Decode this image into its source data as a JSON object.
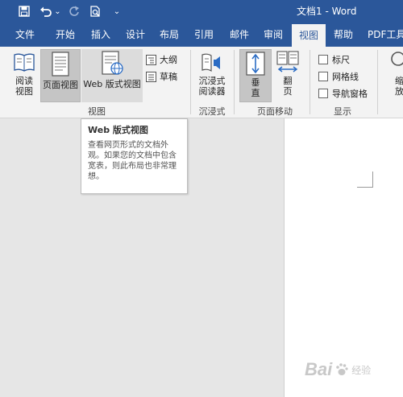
{
  "window": {
    "title": "文档1 - Word"
  },
  "quick_access": {
    "undo_menu": "⌄",
    "customize": "⌄"
  },
  "tabs": [
    {
      "label": "文件"
    },
    {
      "label": "开始"
    },
    {
      "label": "插入"
    },
    {
      "label": "设计"
    },
    {
      "label": "布局"
    },
    {
      "label": "引用"
    },
    {
      "label": "邮件"
    },
    {
      "label": "审阅"
    },
    {
      "label": "视图"
    },
    {
      "label": "帮助"
    },
    {
      "label": "PDF工具"
    }
  ],
  "active_tab": "视图",
  "ribbon": {
    "views": {
      "read_mode": "阅读\n视图",
      "print_layout": "页面视图",
      "web_layout": "Web 版式视图",
      "outline": "大纲",
      "draft": "草稿",
      "group_label": "视图"
    },
    "immersive": {
      "reader": "沉浸式\n阅读器",
      "group_label": "沉浸式"
    },
    "page_movement": {
      "vertical": "垂\n直",
      "side_to_side": "翻\n页",
      "group_label": "页面移动"
    },
    "show": {
      "ruler": "标尺",
      "gridlines": "网格线",
      "nav_pane": "导航窗格",
      "group_label": "显示"
    },
    "zoom": {
      "partial": "缩\n放"
    }
  },
  "tooltip": {
    "title": "Web 版式视图",
    "body": "查看网页形式的文档外观。如果您的文档中包含宽表，则此布局也非常理想。"
  },
  "watermark": {
    "text": "Bai",
    "sub": "经验"
  },
  "colors": {
    "brand": "#2b579a",
    "ribbon_bg": "#f3f3f3",
    "selected_btn": "#c5c5c5"
  }
}
